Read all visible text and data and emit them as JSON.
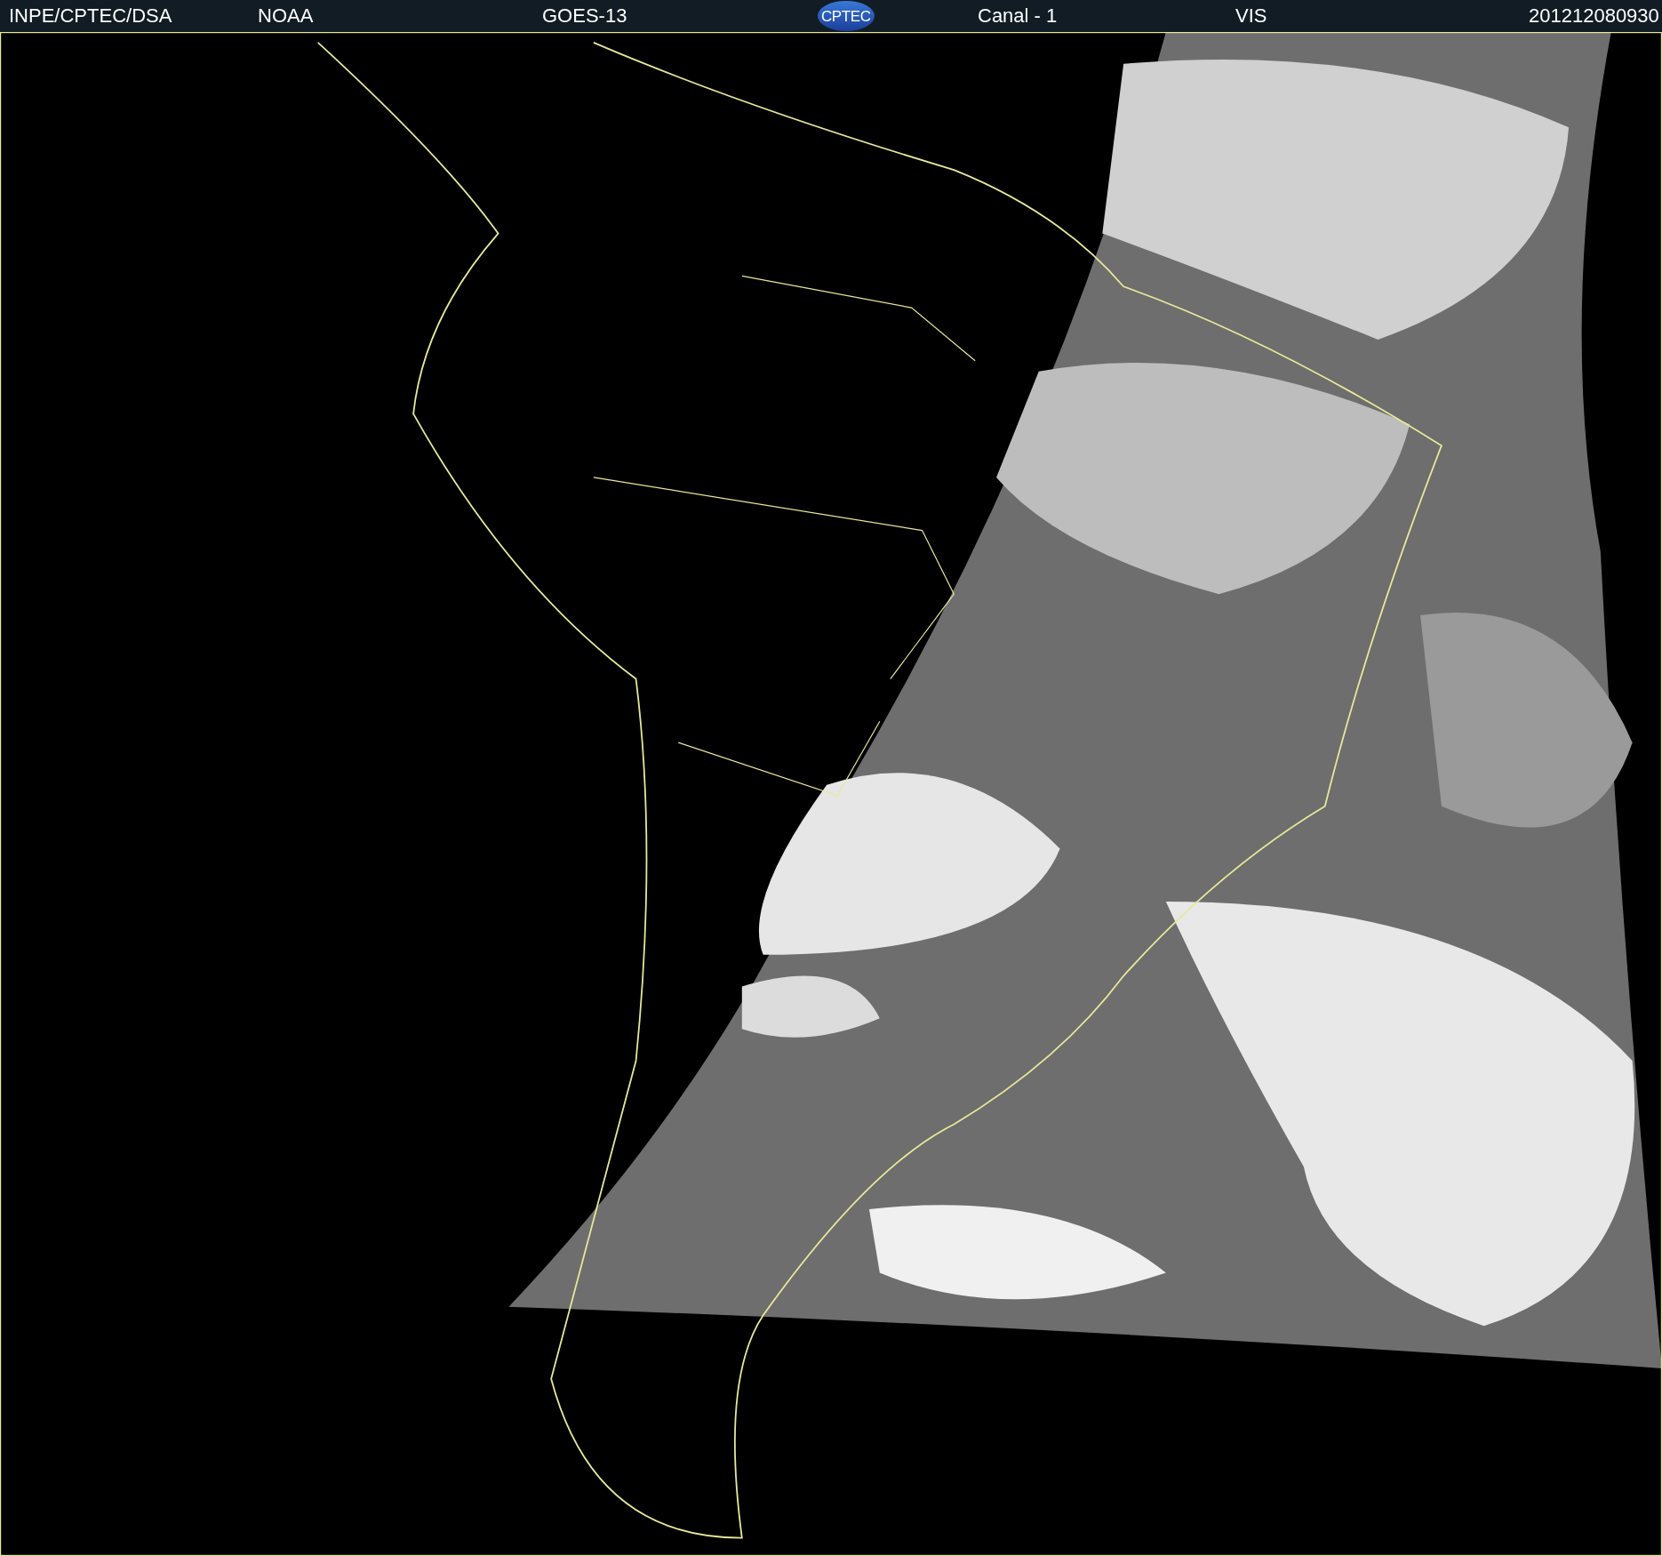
{
  "header": {
    "items": [
      {
        "kind": "text",
        "text": "INPE/CPTEC/DSA"
      },
      {
        "kind": "text",
        "text": "NOAA"
      },
      {
        "kind": "text",
        "text": "GOES-13"
      },
      {
        "kind": "logo",
        "text": "CPTEC"
      },
      {
        "kind": "text",
        "text": "Canal - 1"
      },
      {
        "kind": "text",
        "text": "VIS"
      },
      {
        "kind": "text",
        "text": "201212080930"
      }
    ]
  }
}
